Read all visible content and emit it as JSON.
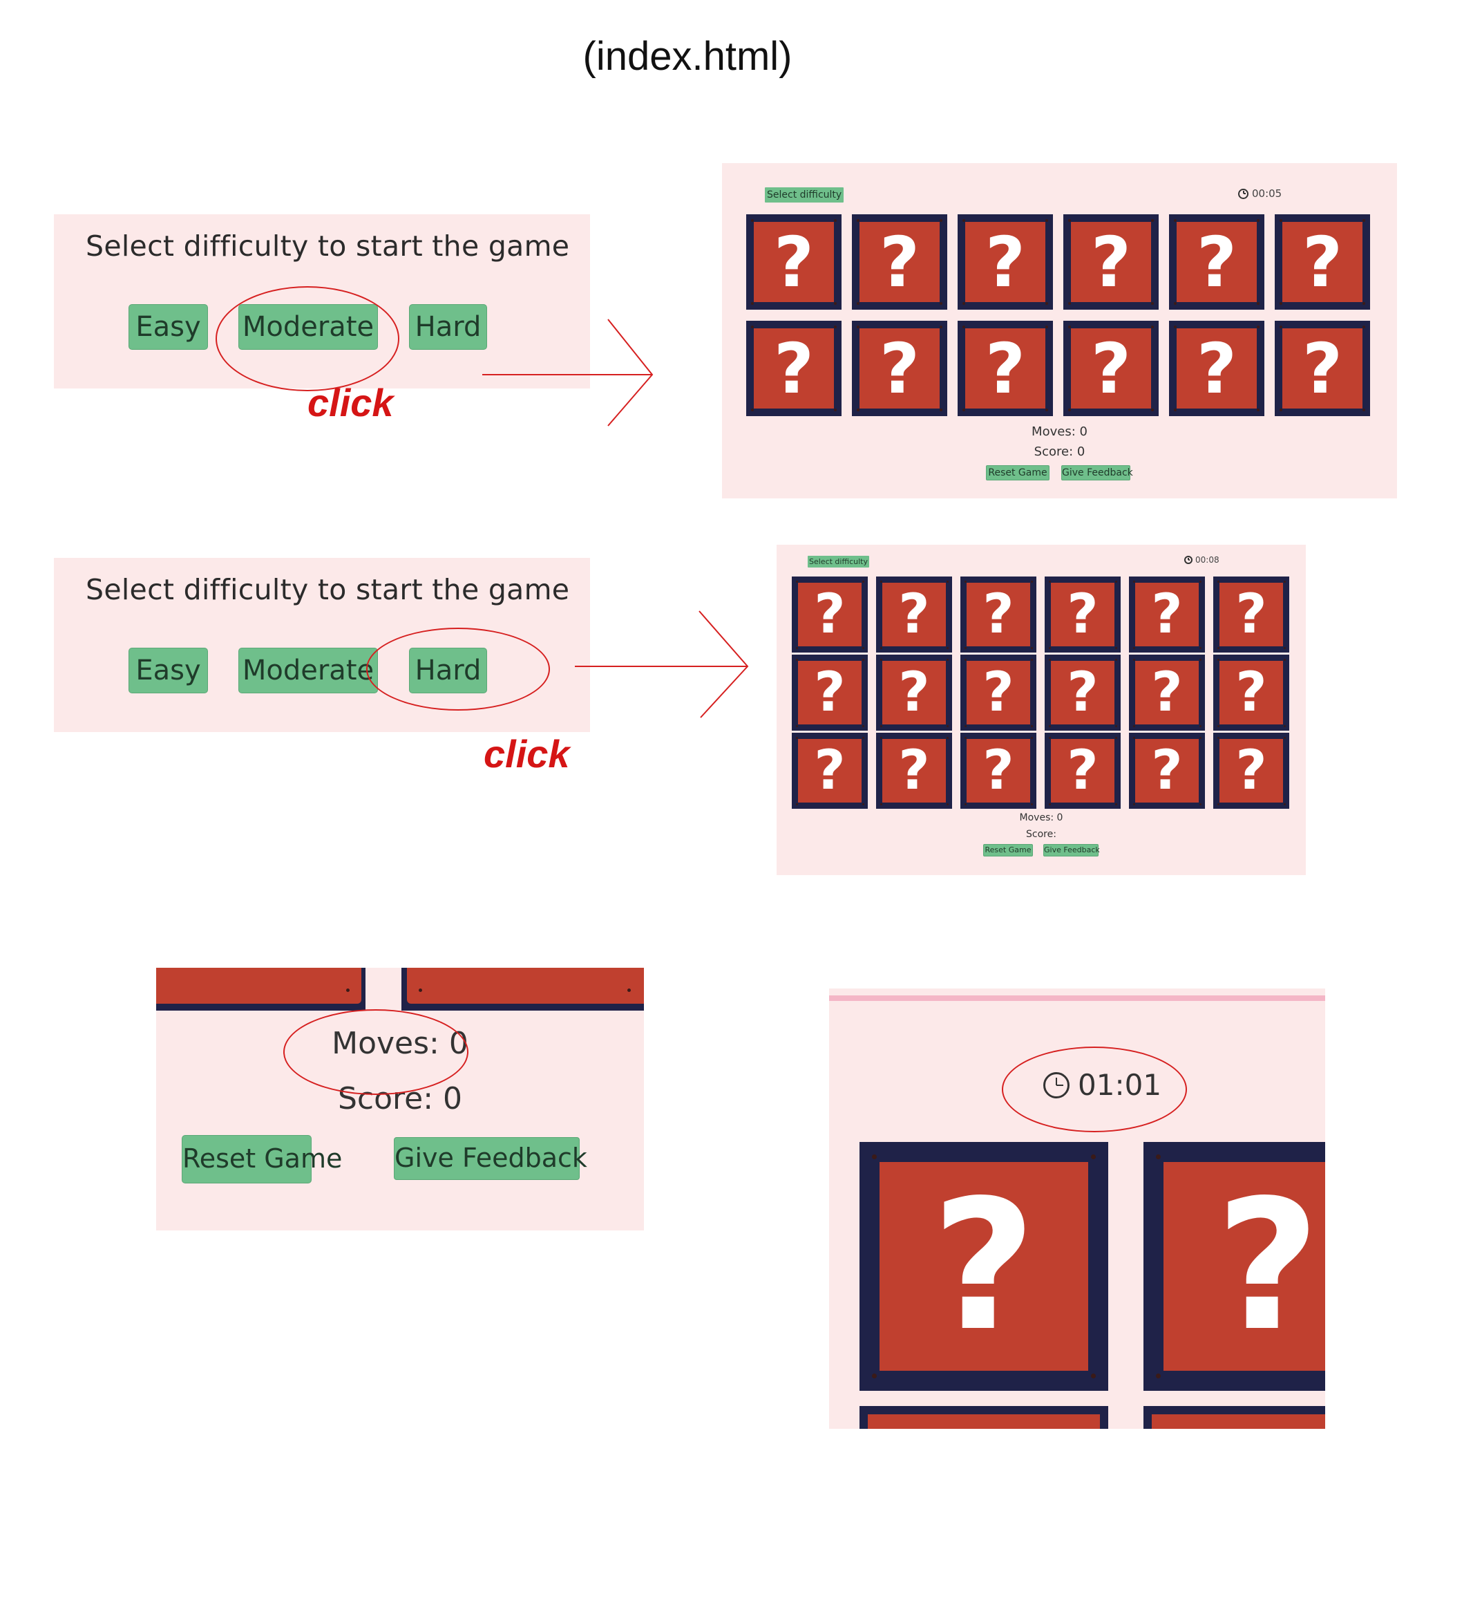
{
  "title": "(index.html)",
  "difficulty_panel": {
    "heading": "Select difficulty to start the game",
    "easy": "Easy",
    "moderate": "Moderate",
    "hard": "Hard"
  },
  "annotation": {
    "click": "click"
  },
  "moderate_game": {
    "select_button": "Select difficulty",
    "timer": "00:05",
    "moves": "Moves: 0",
    "score": "Score: 0",
    "reset": "Reset Game",
    "feedback": "Give Feedback",
    "rows": 2,
    "cols": 6,
    "card_symbol": "?"
  },
  "hard_game": {
    "select_button": "Select difficulty",
    "timer": "00:08",
    "moves": "Moves: 0",
    "score": "Score:",
    "reset": "Reset Game",
    "feedback": "Give Feedback",
    "rows": 3,
    "cols": 6,
    "card_symbol": "?"
  },
  "zoom_stats": {
    "moves": "Moves: 0",
    "score": "Score: 0",
    "reset": "Reset Game",
    "feedback": "Give Feedback"
  },
  "zoom_timer": {
    "timer": "01:01",
    "card_symbol": "?"
  },
  "colors": {
    "panel_bg": "#fce9e9",
    "button_green": "#6fbf8b",
    "card_red": "#c0402f",
    "card_border": "#1f2248",
    "annotation_red": "#d62020"
  }
}
